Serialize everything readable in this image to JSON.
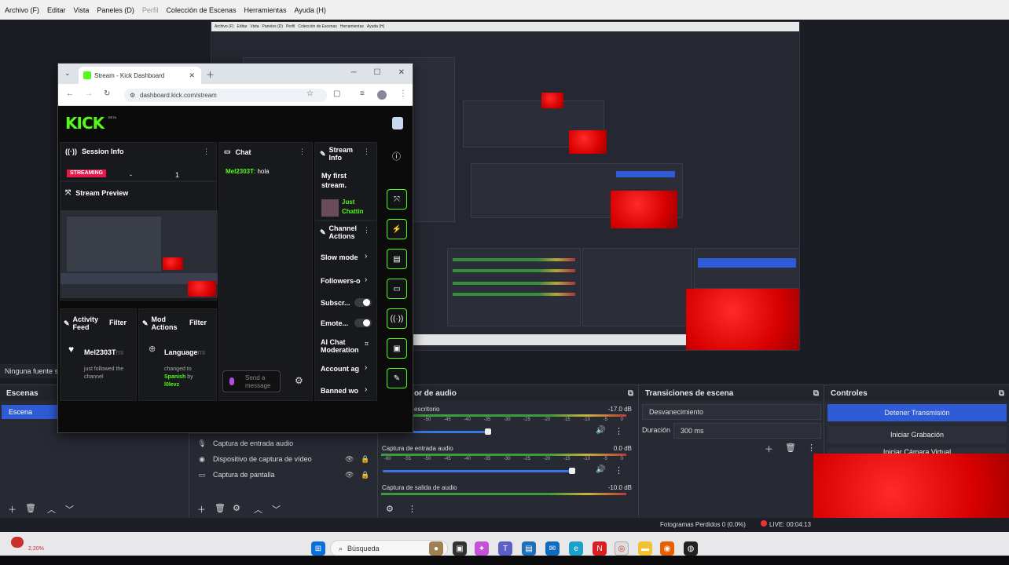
{
  "obs": {
    "menu": [
      "Archivo (F)",
      "Editar",
      "Vista",
      "Paneles (D)",
      "Perfil",
      "Colección de Escenas",
      "Herramientas",
      "Ayuda (H)"
    ],
    "no_source": "Ninguna fuente s",
    "scenes": {
      "title": "Escenas",
      "items": [
        "Escena"
      ]
    },
    "sources": {
      "items": [
        "Captura de entrada audio",
        "Dispositivo de captura de vídeo",
        "Captura de pantalla"
      ]
    },
    "mixer": {
      "title": "or de audio",
      "tracks": [
        {
          "name": "escritorio",
          "db": "-17.0 dB",
          "level": 0.48
        },
        {
          "name": "Captura de entrada audio",
          "db": "0.0 dB",
          "level": 0.86
        },
        {
          "name": "Captura de salida de audio",
          "db": "-10.0 dB",
          "level": 0.0
        }
      ],
      "scale": [
        "-60",
        "-55",
        "-50",
        "-45",
        "-40",
        "-35",
        "-30",
        "-25",
        "-20",
        "-15",
        "-10",
        "-5",
        "0"
      ]
    },
    "transitions": {
      "title": "Transiciones de escena",
      "type": "Desvanecimiento",
      "duration_label": "Duración",
      "duration_value": "300 ms"
    },
    "controls": {
      "title": "Controles",
      "stop_stream": "Detener Transmisión",
      "start_record": "Iniciar Grabación",
      "virtual_cam": "Iniciar Cámara Virtual"
    },
    "status": {
      "dropped": "Fotogramas Perdidos 0 (0.0%)",
      "live": "LIVE: 00:04:13"
    }
  },
  "browser": {
    "tab_title": "Stream - Kick Dashboard",
    "url": "dashboard.kick.com/stream",
    "logo": "KICK",
    "beta": "BETA",
    "session_info": {
      "title": "Session Info",
      "badge": "STREAMING",
      "dash": "-",
      "count": "1"
    },
    "stream_preview": {
      "title": "Stream Preview"
    },
    "chat": {
      "title": "Chat",
      "user": "Mel2303T",
      "message": ": hola",
      "placeholder": "Send a message"
    },
    "stream_info": {
      "title": "Stream Info",
      "stream_title": "My first stream.",
      "category": "Just Chattin"
    },
    "channel_actions": {
      "title": "Channel Actions",
      "items": [
        "Slow mode",
        "Followers-o",
        "Subscr...",
        "Emote...",
        "AI Chat Moderation",
        "Account ag",
        "Banned wo"
      ]
    },
    "activity_feed": {
      "title": "Activity Feed",
      "filter": "Filter",
      "user": "Mel2303T",
      "user_suffix": "mi",
      "text": "just followed the channel"
    },
    "mod_actions": {
      "title": "Mod Actions",
      "filter": "Filter",
      "heading": "Language",
      "heading_suffix": "mi",
      "pre": "changed to",
      "lang": "Spanish",
      "by": "by",
      "mod": "l0levz"
    }
  },
  "taskbar": {
    "search": "Búsqueda",
    "weather_temp": "2,20%"
  },
  "colors": {
    "kick_green": "#53fc18",
    "obs_blue": "#2f5cd6",
    "streaming_red": "#e8174a"
  }
}
